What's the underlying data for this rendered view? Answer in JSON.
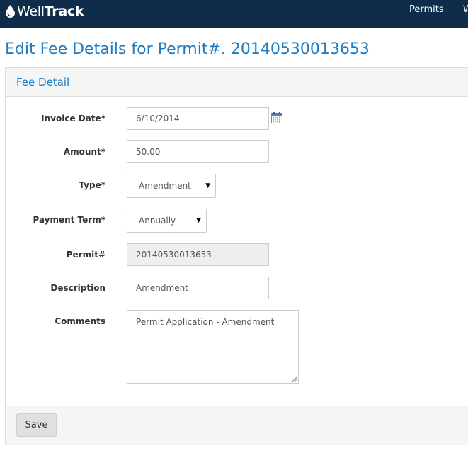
{
  "app": {
    "brand_prefix": "Well",
    "brand_bold": "Track"
  },
  "nav": {
    "permits": "Permits",
    "next": "W"
  },
  "page": {
    "title": "Edit Fee Details for Permit#. 20140530013653"
  },
  "panel": {
    "heading": "Fee Detail"
  },
  "form": {
    "invoice_date": {
      "label": "Invoice Date*",
      "value": "6/10/2014"
    },
    "amount": {
      "label": "Amount*",
      "value": "50.00"
    },
    "type": {
      "label": "Type*",
      "selected": "Amendment"
    },
    "payment_term": {
      "label": "Payment Term*",
      "selected": "Annually"
    },
    "permit": {
      "label": "Permit#",
      "value": "20140530013653"
    },
    "description": {
      "label": "Description",
      "value": "Amendment"
    },
    "comments": {
      "label": "Comments",
      "value": "Permit Application - Amendment"
    }
  },
  "actions": {
    "save": "Save"
  },
  "colors": {
    "navbar": "#0f2d4a",
    "accent": "#1f7cc2"
  }
}
